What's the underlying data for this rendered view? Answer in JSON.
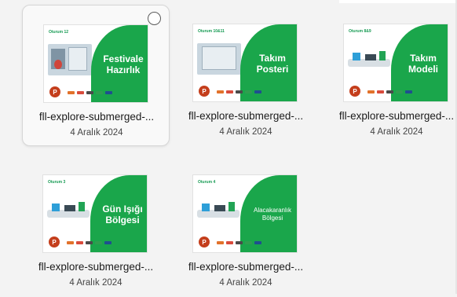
{
  "files": [
    {
      "name": "fll-explore-submerged-...",
      "date": "4 Aralık 2024",
      "slide_tag": "Oturum 12",
      "slide_title_line1": "Festivale",
      "slide_title_line2": "Hazırlık",
      "selected": true
    },
    {
      "name": "fll-explore-submerged-...",
      "date": "4 Aralık 2024",
      "slide_tag": "Oturum 10&11",
      "slide_title_line1": "Takım",
      "slide_title_line2": "Posteri",
      "selected": false
    },
    {
      "name": "fll-explore-submerged-...",
      "date": "4 Aralık 2024",
      "slide_tag": "Oturum 8&9",
      "slide_title_line1": "Takım",
      "slide_title_line2": "Modeli",
      "selected": false
    },
    {
      "name": "fll-explore-submerged-...",
      "date": "4 Aralık 2024",
      "slide_tag": "Oturum 3",
      "slide_title_line1": "Gün Işığı",
      "slide_title_line2": "Bölgesi",
      "selected": false
    },
    {
      "name": "fll-explore-submerged-...",
      "date": "4 Aralık 2024",
      "slide_tag": "Oturum 4",
      "slide_title_line1": "Alacakaranlık",
      "slide_title_line2": "Bölgesi",
      "selected": false
    }
  ],
  "icons": {
    "file_type": "powerpoint-icon",
    "select": "select-circle-icon"
  },
  "colors": {
    "slide_green": "#1aa64b",
    "ppt_red": "#c43e1c",
    "background": "#f3f3f3"
  },
  "ppt_letter": "P"
}
